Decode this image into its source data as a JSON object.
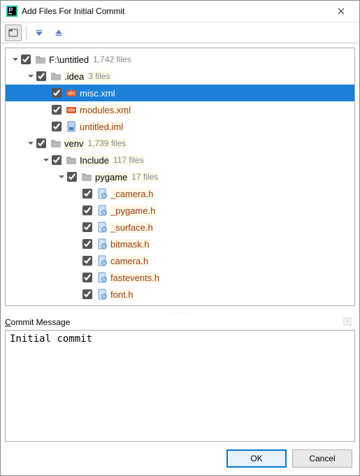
{
  "window": {
    "title": "Add Files For Initial Commit"
  },
  "toolbar": {
    "group_by_directory_active": true
  },
  "tree": [
    {
      "depth": 0,
      "expanded": true,
      "checked": true,
      "kind": "root",
      "icon": "folder",
      "name": "F:\\untitled",
      "count": "1,742 files",
      "selected": false
    },
    {
      "depth": 1,
      "expanded": true,
      "checked": true,
      "kind": "dir",
      "icon": "folder",
      "name": ".idea",
      "count": "3 files",
      "selected": false
    },
    {
      "depth": 2,
      "expanded": null,
      "checked": true,
      "kind": "file",
      "icon": "xml",
      "name": "misc.xml",
      "count": null,
      "selected": true
    },
    {
      "depth": 2,
      "expanded": null,
      "checked": true,
      "kind": "file",
      "icon": "xml",
      "name": "modules.xml",
      "count": null,
      "selected": false
    },
    {
      "depth": 2,
      "expanded": null,
      "checked": true,
      "kind": "file",
      "icon": "iml",
      "name": "untitled.iml",
      "count": null,
      "selected": false
    },
    {
      "depth": 1,
      "expanded": true,
      "checked": true,
      "kind": "dir",
      "icon": "folder",
      "name": "venv",
      "count": "1,739 files",
      "selected": false
    },
    {
      "depth": 2,
      "expanded": true,
      "checked": true,
      "kind": "dir",
      "icon": "folder",
      "name": "Include",
      "count": "117 files",
      "selected": false
    },
    {
      "depth": 3,
      "expanded": true,
      "checked": true,
      "kind": "dir",
      "icon": "folder",
      "name": "pygame",
      "count": "17 files",
      "selected": false
    },
    {
      "depth": 4,
      "expanded": null,
      "checked": true,
      "kind": "file",
      "icon": "header",
      "name": "_camera.h",
      "count": null,
      "selected": false
    },
    {
      "depth": 4,
      "expanded": null,
      "checked": true,
      "kind": "file",
      "icon": "header",
      "name": "_pygame.h",
      "count": null,
      "selected": false
    },
    {
      "depth": 4,
      "expanded": null,
      "checked": true,
      "kind": "file",
      "icon": "header",
      "name": "_surface.h",
      "count": null,
      "selected": false
    },
    {
      "depth": 4,
      "expanded": null,
      "checked": true,
      "kind": "file",
      "icon": "header",
      "name": "bitmask.h",
      "count": null,
      "selected": false
    },
    {
      "depth": 4,
      "expanded": null,
      "checked": true,
      "kind": "file",
      "icon": "header",
      "name": "camera.h",
      "count": null,
      "selected": false
    },
    {
      "depth": 4,
      "expanded": null,
      "checked": true,
      "kind": "file",
      "icon": "header",
      "name": "fastevents.h",
      "count": null,
      "selected": false
    },
    {
      "depth": 4,
      "expanded": null,
      "checked": true,
      "kind": "file",
      "icon": "header",
      "name": "font.h",
      "count": null,
      "selected": false
    }
  ],
  "commit": {
    "label_c": "C",
    "label_rest": "ommit Message",
    "value": "Initial commit"
  },
  "buttons": {
    "ok": "OK",
    "cancel": "Cancel"
  }
}
